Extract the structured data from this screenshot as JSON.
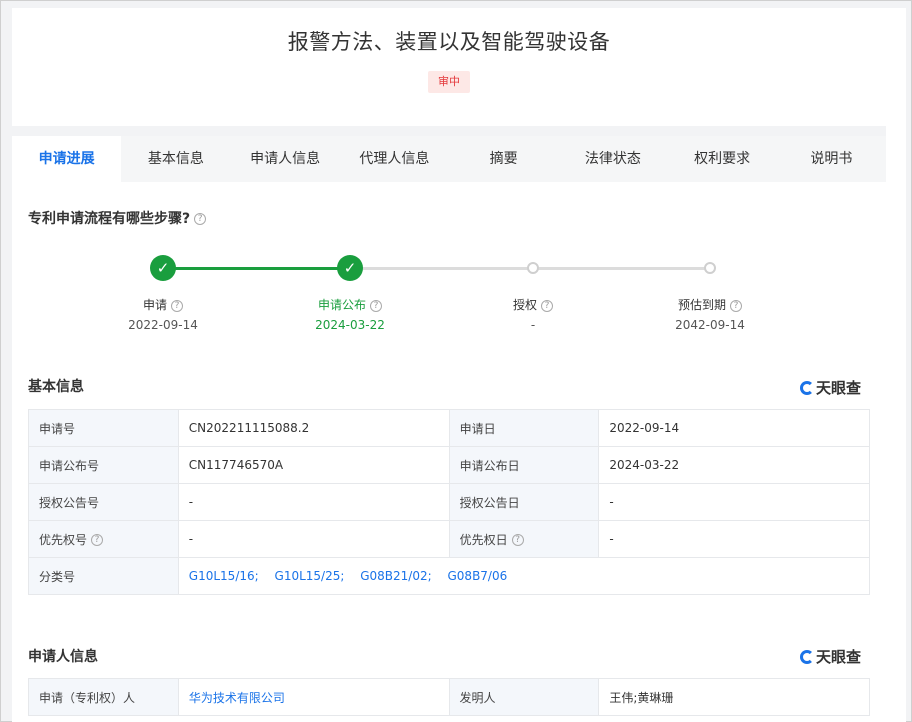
{
  "header": {
    "title": "报警方法、装置以及智能驾驶设备",
    "status": "审中"
  },
  "tabs": [
    "申请进展",
    "基本信息",
    "申请人信息",
    "代理人信息",
    "摘要",
    "法律状态",
    "权利要求",
    "说明书"
  ],
  "progress": {
    "heading": "专利申请流程有哪些步骤?",
    "steps": [
      {
        "label": "申请",
        "date": "2022-09-14",
        "done": true
      },
      {
        "label": "申请公布",
        "date": "2024-03-22",
        "done": true
      },
      {
        "label": "授权",
        "date": "-",
        "done": false
      },
      {
        "label": "预估到期",
        "date": "2042-09-14",
        "done": false
      }
    ]
  },
  "brand": {
    "name": "天眼查"
  },
  "basic_info": {
    "heading": "基本信息",
    "rows": [
      {
        "k1": "申请号",
        "v1": "CN202211115088.2",
        "k2": "申请日",
        "v2": "2022-09-14"
      },
      {
        "k1": "申请公布号",
        "v1": "CN117746570A",
        "k2": "申请公布日",
        "v2": "2024-03-22"
      },
      {
        "k1": "授权公告号",
        "v1": "-",
        "k2": "授权公告日",
        "v2": "-"
      },
      {
        "k1": "优先权号",
        "v1": "-",
        "k2": "优先权日",
        "v2": "-"
      }
    ],
    "classification_label": "分类号",
    "classifications": [
      "G10L15/16;",
      "G10L15/25;",
      "G08B21/02;",
      "G08B7/06"
    ]
  },
  "applicant_info": {
    "heading": "申请人信息",
    "applicant_label": "申请（专利权）人",
    "applicant": "华为技术有限公司",
    "inventor_label": "发明人",
    "inventor": "王伟;黄琳珊"
  }
}
